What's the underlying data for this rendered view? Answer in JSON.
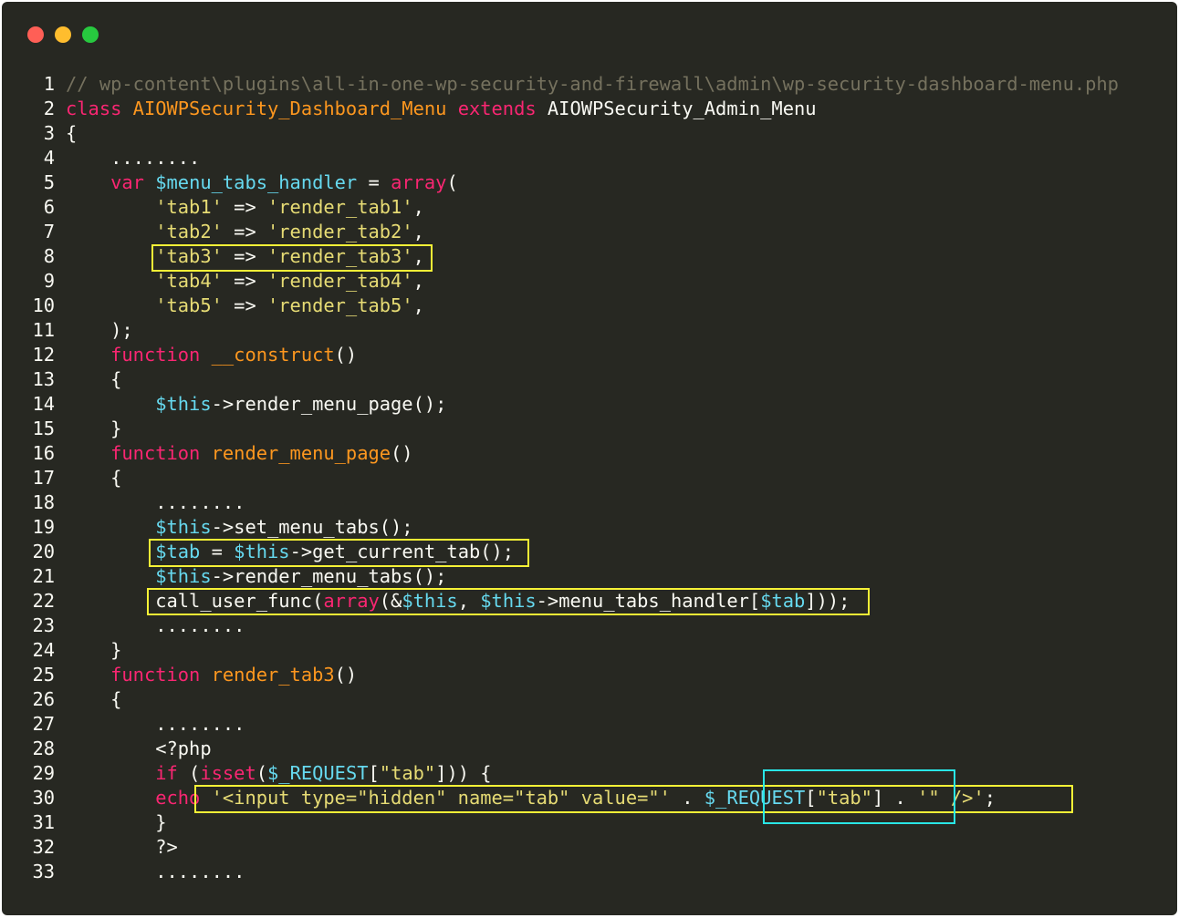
{
  "window": {
    "controls": {
      "close_color": "#ff5f56",
      "minimize_color": "#ffbd2e",
      "maximize_color": "#27c93f"
    },
    "theme": {
      "background": "#272822",
      "keyword": "#f92672",
      "type": "#fd971f",
      "string": "#e6db74",
      "variable": "#66d9ef",
      "comment": "#75715e",
      "highlight_yellow": "#f6f236",
      "highlight_cyan": "#29e6e6"
    }
  },
  "code": {
    "line_numbers": [
      "1",
      "2",
      "3",
      "4",
      "5",
      "6",
      "7",
      "8",
      "9",
      "10",
      "11",
      "12",
      "13",
      "14",
      "15",
      "16",
      "17",
      "18",
      "19",
      "20",
      "21",
      "22",
      "23",
      "24",
      "25",
      "26",
      "27",
      "28",
      "29",
      "30",
      "31",
      "32",
      "33"
    ],
    "lines": [
      [
        {
          "c": "c",
          "t": "// wp-content\\plugins\\all-in-one-wp-security-and-firewall\\admin\\wp-security-dashboard-menu.php"
        }
      ],
      [
        {
          "c": "k",
          "t": "class"
        },
        {
          "c": "",
          "t": " "
        },
        {
          "c": "t",
          "t": "AIOWPSecurity_Dashboard_Menu"
        },
        {
          "c": "",
          "t": " "
        },
        {
          "c": "k",
          "t": "extends"
        },
        {
          "c": "",
          "t": " AIOWPSecurity_Admin_Menu"
        }
      ],
      [
        {
          "c": "",
          "t": "{"
        }
      ],
      [
        {
          "c": "",
          "t": "    ........"
        }
      ],
      [
        {
          "c": "",
          "t": "    "
        },
        {
          "c": "k",
          "t": "var"
        },
        {
          "c": "",
          "t": " "
        },
        {
          "c": "v",
          "t": "$menu_tabs_handler"
        },
        {
          "c": "",
          "t": " = "
        },
        {
          "c": "k",
          "t": "array"
        },
        {
          "c": "",
          "t": "("
        }
      ],
      [
        {
          "c": "",
          "t": "        "
        },
        {
          "c": "s",
          "t": "'tab1'"
        },
        {
          "c": "",
          "t": " => "
        },
        {
          "c": "s",
          "t": "'render_tab1'"
        },
        {
          "c": "",
          "t": ","
        }
      ],
      [
        {
          "c": "",
          "t": "        "
        },
        {
          "c": "s",
          "t": "'tab2'"
        },
        {
          "c": "",
          "t": " => "
        },
        {
          "c": "s",
          "t": "'render_tab2'"
        },
        {
          "c": "",
          "t": ","
        }
      ],
      [
        {
          "c": "",
          "t": "        "
        },
        {
          "c": "s",
          "t": "'tab3'"
        },
        {
          "c": "",
          "t": " => "
        },
        {
          "c": "s",
          "t": "'render_tab3'"
        },
        {
          "c": "",
          "t": ","
        }
      ],
      [
        {
          "c": "",
          "t": "        "
        },
        {
          "c": "s",
          "t": "'tab4'"
        },
        {
          "c": "",
          "t": " => "
        },
        {
          "c": "s",
          "t": "'render_tab4'"
        },
        {
          "c": "",
          "t": ","
        }
      ],
      [
        {
          "c": "",
          "t": "        "
        },
        {
          "c": "s",
          "t": "'tab5'"
        },
        {
          "c": "",
          "t": " => "
        },
        {
          "c": "s",
          "t": "'render_tab5'"
        },
        {
          "c": "",
          "t": ","
        }
      ],
      [
        {
          "c": "",
          "t": "    );"
        }
      ],
      [
        {
          "c": "",
          "t": "    "
        },
        {
          "c": "k",
          "t": "function"
        },
        {
          "c": "",
          "t": " "
        },
        {
          "c": "t",
          "t": "__construct"
        },
        {
          "c": "",
          "t": "()"
        }
      ],
      [
        {
          "c": "",
          "t": "    {"
        }
      ],
      [
        {
          "c": "",
          "t": "        "
        },
        {
          "c": "v",
          "t": "$this"
        },
        {
          "c": "",
          "t": "->render_menu_page();"
        }
      ],
      [
        {
          "c": "",
          "t": "    }"
        }
      ],
      [
        {
          "c": "",
          "t": "    "
        },
        {
          "c": "k",
          "t": "function"
        },
        {
          "c": "",
          "t": " "
        },
        {
          "c": "t",
          "t": "render_menu_page"
        },
        {
          "c": "",
          "t": "()"
        }
      ],
      [
        {
          "c": "",
          "t": "    {"
        }
      ],
      [
        {
          "c": "",
          "t": "        ........"
        }
      ],
      [
        {
          "c": "",
          "t": "        "
        },
        {
          "c": "v",
          "t": "$this"
        },
        {
          "c": "",
          "t": "->set_menu_tabs();"
        }
      ],
      [
        {
          "c": "",
          "t": "        "
        },
        {
          "c": "v",
          "t": "$tab"
        },
        {
          "c": "",
          "t": " = "
        },
        {
          "c": "v",
          "t": "$this"
        },
        {
          "c": "",
          "t": "->get_current_tab();"
        }
      ],
      [
        {
          "c": "",
          "t": "        "
        },
        {
          "c": "v",
          "t": "$this"
        },
        {
          "c": "",
          "t": "->render_menu_tabs();"
        }
      ],
      [
        {
          "c": "",
          "t": "        call_user_func("
        },
        {
          "c": "k",
          "t": "array"
        },
        {
          "c": "",
          "t": "(&"
        },
        {
          "c": "v",
          "t": "$this"
        },
        {
          "c": "",
          "t": ", "
        },
        {
          "c": "v",
          "t": "$this"
        },
        {
          "c": "",
          "t": "->menu_tabs_handler["
        },
        {
          "c": "v",
          "t": "$tab"
        },
        {
          "c": "",
          "t": "]));"
        }
      ],
      [
        {
          "c": "",
          "t": "        ........"
        }
      ],
      [
        {
          "c": "",
          "t": "    }"
        }
      ],
      [
        {
          "c": "",
          "t": "    "
        },
        {
          "c": "k",
          "t": "function"
        },
        {
          "c": "",
          "t": " "
        },
        {
          "c": "t",
          "t": "render_tab3"
        },
        {
          "c": "",
          "t": "()"
        }
      ],
      [
        {
          "c": "",
          "t": "    {"
        }
      ],
      [
        {
          "c": "",
          "t": "        ........"
        }
      ],
      [
        {
          "c": "",
          "t": "        <?php"
        }
      ],
      [
        {
          "c": "",
          "t": "        "
        },
        {
          "c": "k",
          "t": "if"
        },
        {
          "c": "",
          "t": " ("
        },
        {
          "c": "k",
          "t": "isset"
        },
        {
          "c": "",
          "t": "("
        },
        {
          "c": "v",
          "t": "$_REQUEST"
        },
        {
          "c": "",
          "t": "["
        },
        {
          "c": "s",
          "t": "\"tab\""
        },
        {
          "c": "",
          "t": "])) {"
        }
      ],
      [
        {
          "c": "",
          "t": "        "
        },
        {
          "c": "k",
          "t": "echo"
        },
        {
          "c": "",
          "t": " "
        },
        {
          "c": "s",
          "t": "'<input type=\"hidden\" name=\"tab\" value=\"'"
        },
        {
          "c": "",
          "t": " . "
        },
        {
          "c": "v",
          "t": "$_REQUEST"
        },
        {
          "c": "",
          "t": "["
        },
        {
          "c": "s",
          "t": "\"tab\""
        },
        {
          "c": "",
          "t": "] . "
        },
        {
          "c": "s",
          "t": "'\" />'"
        },
        {
          "c": "",
          "t": ";"
        }
      ],
      [
        {
          "c": "",
          "t": "        }"
        }
      ],
      [
        {
          "c": "",
          "t": "        ?>"
        }
      ],
      [
        {
          "c": "",
          "t": "        ........"
        }
      ]
    ]
  }
}
